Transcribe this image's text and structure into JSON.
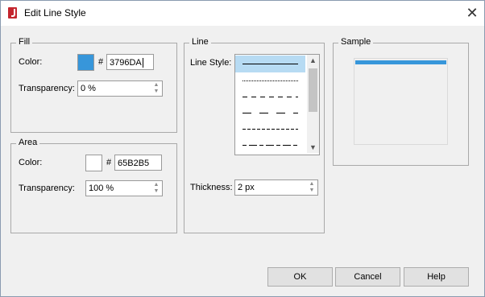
{
  "window": {
    "title": "Edit Line Style"
  },
  "fill": {
    "legend": "Fill",
    "color_label": "Color:",
    "hash": "#",
    "hex": "3796DA",
    "swatch_color": "#3796DA",
    "transparency_label": "Transparency:",
    "transparency": "0 %"
  },
  "area": {
    "legend": "Area",
    "color_label": "Color:",
    "hash": "#",
    "hex": "65B2B5",
    "swatch_color": "#FFFFFF",
    "transparency_label": "Transparency:",
    "transparency": "100 %"
  },
  "line": {
    "legend": "Line",
    "style_label": "Line Style:",
    "styles": [
      "solid",
      "dotted",
      "dashed",
      "long-dash",
      "short-dash",
      "dash-dot"
    ],
    "selected_style": "solid",
    "thickness_label": "Thickness:",
    "thickness": "2 px"
  },
  "sample": {
    "legend": "Sample",
    "line_color": "#3796DA"
  },
  "buttons": {
    "ok": "OK",
    "cancel": "Cancel",
    "help": "Help"
  }
}
